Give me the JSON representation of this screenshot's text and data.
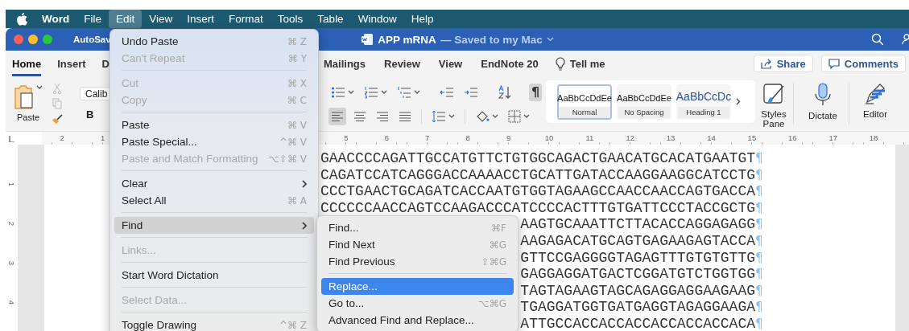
{
  "menu_bar": {
    "items": [
      {
        "label": "Word",
        "kind": "app",
        "selected": false
      },
      {
        "label": "File",
        "kind": "menu",
        "selected": false
      },
      {
        "label": "Edit",
        "kind": "menu",
        "selected": true
      },
      {
        "label": "View",
        "kind": "menu",
        "selected": false
      },
      {
        "label": "Insert",
        "kind": "menu",
        "selected": false
      },
      {
        "label": "Format",
        "kind": "menu",
        "selected": false
      },
      {
        "label": "Tools",
        "kind": "menu",
        "selected": false
      },
      {
        "label": "Table",
        "kind": "menu",
        "selected": false
      },
      {
        "label": "Window",
        "kind": "menu",
        "selected": false
      },
      {
        "label": "Help",
        "kind": "menu",
        "selected": false
      }
    ]
  },
  "title_bar": {
    "autosave": "AutoSav",
    "document": "APP mRNA",
    "status": "— Saved to my Mac"
  },
  "ribbon_tabs": [
    {
      "label": "Home",
      "selected": true
    },
    {
      "label": "Insert",
      "selected": false
    },
    {
      "label": "D",
      "selected": false
    },
    {
      "label": "Mailings",
      "selected": false
    },
    {
      "label": "Review",
      "selected": false
    },
    {
      "label": "View",
      "selected": false
    },
    {
      "label": "EndNote 20",
      "selected": false
    }
  ],
  "tell_me": "Tell me",
  "share": "Share",
  "comments": "Comments",
  "ribbon": {
    "paste": "Paste",
    "font": "Calib",
    "bold": "B",
    "formatting_marks": {
      "label": "¶",
      "on": true
    },
    "alignment": [
      {
        "kind": "left",
        "selected": true
      },
      {
        "kind": "center",
        "selected": false
      },
      {
        "kind": "right",
        "selected": false
      },
      {
        "kind": "justify",
        "selected": false
      }
    ]
  },
  "styles": [
    {
      "preview": "AaBbCcDdEe",
      "name": "Normal",
      "kind": "body",
      "selected": true
    },
    {
      "preview": "AaBbCcDdEe",
      "name": "No Spacing",
      "kind": "body",
      "selected": false
    },
    {
      "preview": "AaBbCcDc",
      "name": "Heading 1",
      "kind": "heading",
      "selected": false
    }
  ],
  "big_buttons": [
    {
      "kind": "styles-pane",
      "label": "Styles Pane"
    },
    {
      "kind": "dictate",
      "label": "Dictate"
    },
    {
      "kind": "editor",
      "label": "Editor"
    }
  ],
  "ruler": {
    "left_numbers": [
      "2",
      "1"
    ],
    "right_numbers": [
      "5",
      "6",
      "7",
      "8",
      "9",
      "10",
      "11",
      "12",
      "13",
      "14",
      "15",
      "16",
      "17",
      "18"
    ]
  },
  "vertical_ruler": [
    "1",
    "2",
    "3",
    "4"
  ],
  "document": {
    "lines": [
      {
        "text": "GAACCCCAGATTGCCATGTTCTGTGGCAGACTGAACATGCACATGAATGT",
        "mark": "¶"
      },
      {
        "text": "CAGATCCATCAGGGACCAAAACCTGCATTGATACCAAGGAAGGCATCCTG",
        "mark": "¶"
      },
      {
        "text": "CCCTGAACTGCAGATCACCAATGTGGTAGAAGCCAACCAACCAGTGACCA",
        "mark": "¶"
      },
      {
        "text": "CCCCCCAACCAGTCCAAGACCCATCCCCACTTTGTGATTCCCTACCGCTG",
        "mark": "¶"
      },
      {
        "text": "AAGTGCAAATTCTTACACCAGGAGAGG",
        "mark": "¶"
      },
      {
        "text": "AAGAGACATGCAGTGAGAAGAGTACCA",
        "mark": "¶"
      },
      {
        "text": "GTTCCGAGGGGTAGAGTTTGTGTGTTG",
        "mark": "¶"
      },
      {
        "text": "GAGGAGGATGACTCGGATGTCTGGTGG",
        "mark": "¶"
      },
      {
        "text": "TAGTAGAAGTAGCAGAGGAGGAAGAAG",
        "mark": "¶"
      },
      {
        "text": "TGAGGATGGTGATGAGGTAGAGGAAGA",
        "mark": "¶"
      },
      {
        "text": "ATTGCCACCACCACCACCACCACCACA",
        "mark": "¶"
      }
    ]
  },
  "edit_menu": {
    "items": [
      {
        "kind": "item",
        "label": "Undo Paste",
        "shortcut": "⌘ Z",
        "disabled": false,
        "selected": false
      },
      {
        "kind": "item",
        "label": "Can't Repeat",
        "shortcut": "⌘ Y",
        "disabled": true,
        "selected": false
      },
      {
        "kind": "separator"
      },
      {
        "kind": "item",
        "label": "Cut",
        "shortcut": "⌘ X",
        "disabled": true,
        "selected": false
      },
      {
        "kind": "item",
        "label": "Copy",
        "shortcut": "⌘ C",
        "disabled": true,
        "selected": false
      },
      {
        "kind": "separator"
      },
      {
        "kind": "item",
        "label": "Paste",
        "shortcut": "⌘ V",
        "disabled": false,
        "selected": false
      },
      {
        "kind": "item",
        "label": "Paste Special...",
        "shortcut": "^⌘ V",
        "disabled": false,
        "selected": false
      },
      {
        "kind": "item",
        "label": "Paste and Match Formatting",
        "shortcut": "⌥⇧⌘ V",
        "disabled": true,
        "selected": false
      },
      {
        "kind": "separator"
      },
      {
        "kind": "submenu",
        "label": "Clear",
        "disabled": false,
        "selected": false
      },
      {
        "kind": "item",
        "label": "Select All",
        "shortcut": "⌘ A",
        "disabled": false,
        "selected": false
      },
      {
        "kind": "separator"
      },
      {
        "kind": "submenu",
        "label": "Find",
        "disabled": false,
        "selected": true
      },
      {
        "kind": "separator"
      },
      {
        "kind": "item",
        "label": "Links...",
        "disabled": true,
        "selected": false
      },
      {
        "kind": "separator"
      },
      {
        "kind": "item",
        "label": "Start Word Dictation",
        "disabled": false,
        "selected": false
      },
      {
        "kind": "separator"
      },
      {
        "kind": "item",
        "label": "Select Data...",
        "disabled": true,
        "selected": false
      },
      {
        "kind": "separator"
      },
      {
        "kind": "item",
        "label": "Toggle Drawing",
        "shortcut": "^⌘ Z",
        "disabled": false,
        "selected": false
      }
    ]
  },
  "find_menu": {
    "items": [
      {
        "kind": "item",
        "label": "Find...",
        "shortcut": "⌘F",
        "disabled": false,
        "selected": false
      },
      {
        "kind": "item",
        "label": "Find Next",
        "shortcut": "⌘G",
        "disabled": false,
        "selected": false
      },
      {
        "kind": "item",
        "label": "Find Previous",
        "shortcut": "⇧⌘G",
        "disabled": false,
        "selected": false
      },
      {
        "kind": "separator"
      },
      {
        "kind": "item",
        "label": "Replace...",
        "disabled": false,
        "selected": true
      },
      {
        "kind": "item",
        "label": "Go to...",
        "shortcut": "⌥⌘G",
        "disabled": false,
        "selected": false
      },
      {
        "kind": "item",
        "label": "Advanced Find and Replace...",
        "disabled": false,
        "selected": false
      }
    ]
  }
}
